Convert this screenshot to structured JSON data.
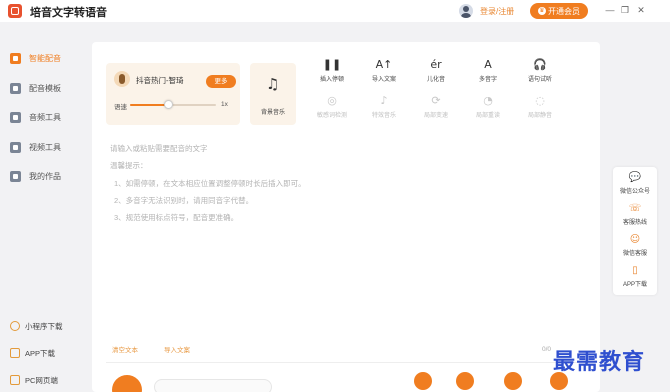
{
  "titlebar": {
    "app_title": "培音文字转语音",
    "login_label": "登录/注册",
    "vip_label": "开通会员",
    "vip_icon": "crown-icon",
    "minimize_label": "—",
    "maximize_label": "❐",
    "close_label": "✕"
  },
  "sidebar": {
    "items": [
      {
        "label": "智能配音",
        "icon": "smart-dub-icon",
        "active": true
      },
      {
        "label": "配音模板",
        "icon": "template-icon"
      },
      {
        "label": "音频工具",
        "icon": "audio-tools-icon"
      },
      {
        "label": "视频工具",
        "icon": "video-tools-icon"
      },
      {
        "label": "我的作品",
        "icon": "folder-icon"
      }
    ],
    "bottom_items": [
      {
        "label": "小程序下载",
        "icon": "mini-program-icon"
      },
      {
        "label": "APP下载",
        "icon": "phone-icon"
      },
      {
        "label": "PC网页端",
        "icon": "monitor-icon"
      }
    ]
  },
  "voice": {
    "name": "抖音热门-智琦",
    "more_label": "更多",
    "speed_label": "语速",
    "speed_value": "1x",
    "speed_fraction": 0.45
  },
  "bgm": {
    "label": "背景音乐",
    "glyph": "♫"
  },
  "tools_row1": [
    {
      "label": "插入停顿",
      "glyph": "❚❚"
    },
    {
      "label": "导入文案",
      "glyph": "A↑"
    },
    {
      "label": "儿化音",
      "glyph": "ér"
    },
    {
      "label": "多音字",
      "glyph": "A"
    },
    {
      "label": "语句试听",
      "glyph": "🎧"
    }
  ],
  "tools_row2": [
    {
      "label": "敏感词检测",
      "glyph": "◎"
    },
    {
      "label": "特效音乐",
      "glyph": "♪"
    },
    {
      "label": "局部变速",
      "glyph": "⟳"
    },
    {
      "label": "局部重读",
      "glyph": "◔"
    },
    {
      "label": "局部静音",
      "glyph": "◌"
    }
  ],
  "editor": {
    "placeholder": "请输入或粘贴需要配音的文字",
    "tips_title": "温馨提示：",
    "tips": [
      "1、如需停顿，在文本相应位置调整停顿时长后插入即可。",
      "2、多音字无法识别时，请用同音字代替。",
      "3、规范使用标点符号，配音更准确。"
    ]
  },
  "actions": {
    "clear_label": "清空文本",
    "import_label": "导入文案"
  },
  "counter": "0/0",
  "rightbar": [
    {
      "label": "微信公众号",
      "glyph": "💬"
    },
    {
      "label": "客服热线",
      "glyph": "☏"
    },
    {
      "label": "微信客服",
      "glyph": "☺"
    },
    {
      "label": "APP下载",
      "glyph": "▯"
    }
  ],
  "watermark": "最需教育",
  "colors": {
    "accent": "#f07d20",
    "panel_bg": "#fbf3e9",
    "watermark": "#2f4fcf"
  }
}
